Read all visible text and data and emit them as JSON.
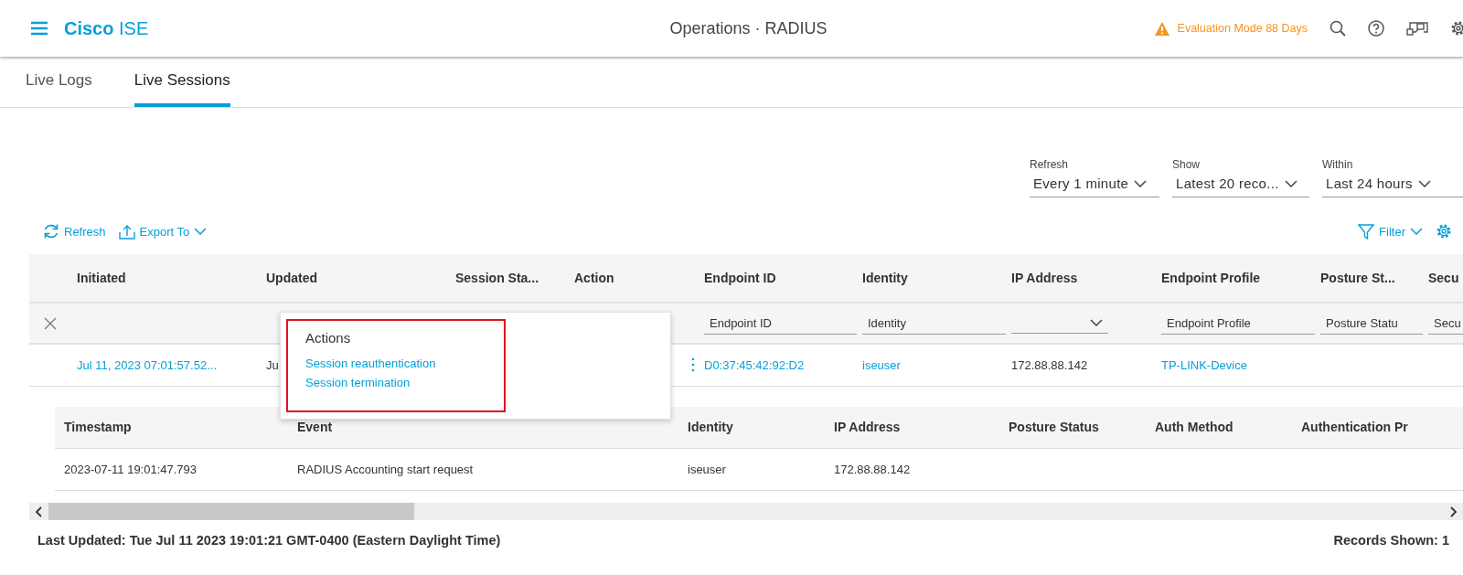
{
  "header": {
    "brand": "**Cisco** ISE",
    "title": "Operations · RADIUS",
    "notice": "Evaluation Mode 88 Days"
  },
  "tabs": [
    {
      "label": "Live Logs",
      "selected": false
    },
    {
      "label": "Live Sessions",
      "selected": true
    }
  ],
  "options": [
    {
      "label": "Refresh",
      "value": "Every 1 minute"
    },
    {
      "label": "Show",
      "value": "Latest 20 reco..."
    },
    {
      "label": "Within",
      "value": "Last 24 hours"
    }
  ],
  "toolbar": {
    "left": [
      {
        "kind": "refresh",
        "label": "Refresh",
        "dropdown": false
      },
      {
        "kind": "export",
        "label": "Export To",
        "dropdown": true
      }
    ],
    "right": [
      {
        "kind": "filter",
        "label": "Filter",
        "dropdown": true
      }
    ]
  },
  "sessions_table": {
    "columns": [
      "Initiated",
      "Updated",
      "Session Sta...",
      "Action",
      "Endpoint ID",
      "Identity",
      "IP Address",
      "Endpoint Profile",
      "Posture St...",
      "Secu"
    ],
    "filters": [
      {
        "kind": "clear"
      },
      {
        "kind": "blank"
      },
      {
        "kind": "blank"
      },
      {
        "kind": "blank"
      },
      {
        "kind": "blank"
      },
      {
        "kind": "input",
        "placeholder": "Endpoint ID"
      },
      {
        "kind": "input",
        "placeholder": "Identity"
      },
      {
        "kind": "select"
      },
      {
        "kind": "input",
        "placeholder": "Endpoint Profile"
      },
      {
        "kind": "input",
        "placeholder": "Posture Statu"
      },
      {
        "kind": "input",
        "placeholder": "Secu"
      }
    ],
    "rows": [
      {
        "cells": [
          {
            "kind": "link",
            "text": "Jul 11, 2023 07:01:57.52..."
          },
          {
            "kind": "text",
            "text": "Ju"
          },
          {
            "kind": "empty"
          },
          {
            "kind": "menu"
          },
          {
            "kind": "link",
            "text": "D0:37:45:42:92:D2"
          },
          {
            "kind": "link",
            "text": "iseuser"
          },
          {
            "kind": "text",
            "text": "172.88.88.142"
          },
          {
            "kind": "link",
            "text": "TP-LINK-Device"
          },
          {
            "kind": "empty"
          },
          {
            "kind": "empty"
          }
        ]
      }
    ]
  },
  "popup": {
    "title": "Actions",
    "items": [
      "Session reauthentication",
      "Session termination"
    ],
    "highlighted": true
  },
  "events_table": {
    "columns": [
      "Timestamp",
      "Event",
      "Identity",
      "IP Address",
      "Posture Status",
      "Auth Method",
      "Authentication Pr"
    ],
    "rows": [
      [
        "2023-07-11 19:01:47.793",
        "RADIUS Accounting start request",
        "iseuser",
        "172.88.88.142",
        "",
        "",
        ""
      ]
    ]
  },
  "status_bar": {
    "last_updated": "Last Updated: Tue Jul 11 2023 19:01:21 GMT-0400 (Eastern Daylight Time)",
    "records": "Records Shown: 1"
  }
}
